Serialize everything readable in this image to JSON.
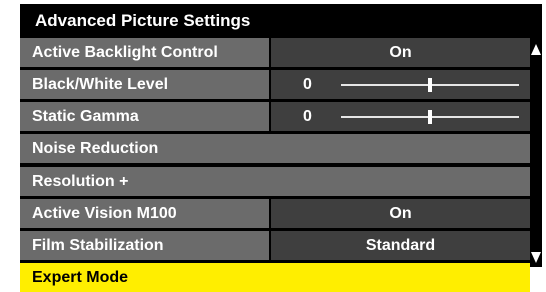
{
  "menu": {
    "title": "Advanced Picture Settings",
    "rows": [
      {
        "label": "Active Backlight Control",
        "value": "On"
      },
      {
        "label": "Black/White Level",
        "value": "0",
        "slider_fraction": 0.5
      },
      {
        "label": "Static Gamma",
        "value": "0",
        "slider_fraction": 0.5
      },
      {
        "label": "Noise Reduction"
      },
      {
        "label": "Resolution +"
      },
      {
        "label": "Active Vision M100",
        "value": "On"
      },
      {
        "label": "Film Stabilization",
        "value": "Standard"
      },
      {
        "label": "Expert Mode",
        "selected": true
      }
    ],
    "scroll_up_icon": "triangle-up-icon",
    "scroll_down_icon": "triangle-down-icon"
  },
  "colors": {
    "background": "#000000",
    "label_bg": "#6b6b6b",
    "value_bg": "#3f3f3f",
    "highlight": "#ffee00"
  }
}
